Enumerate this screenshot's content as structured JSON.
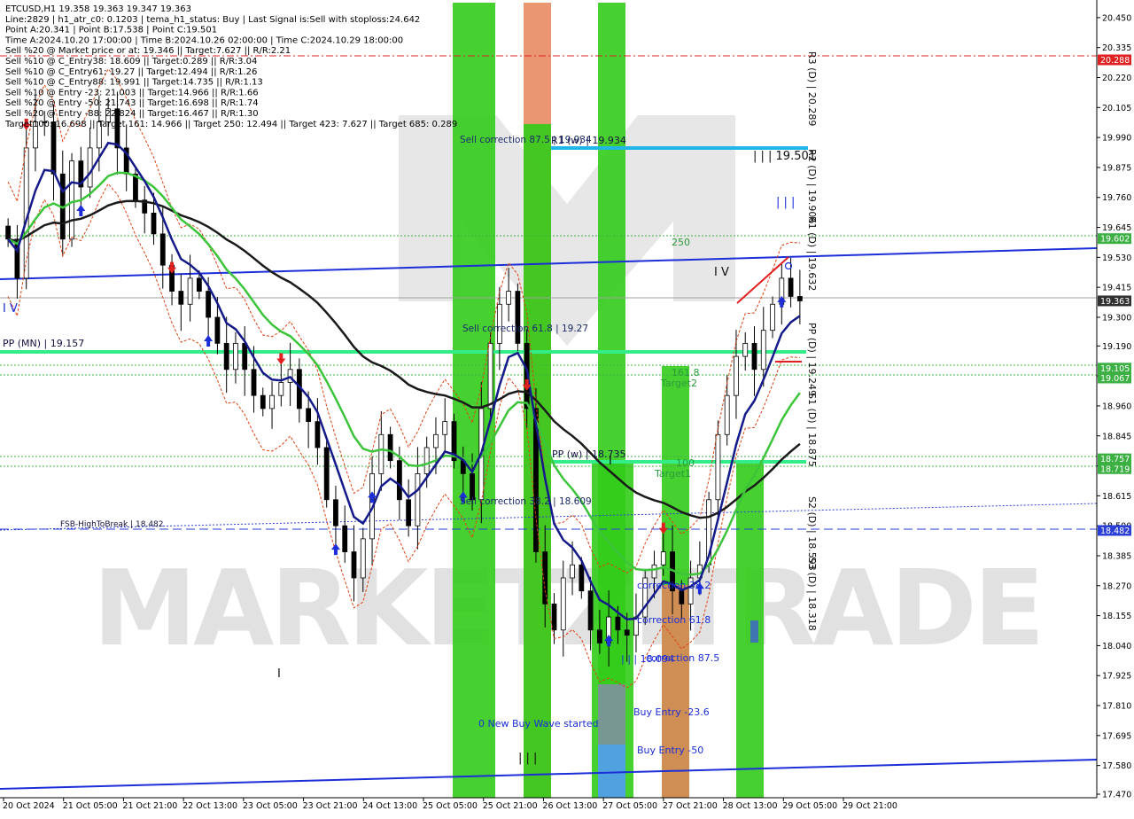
{
  "header": {
    "lines": [
      "ETCUSD,H1  19.358 19.363 19.347 19.363",
      "Line:2829 | h1_atr_c0: 0.1203 | tema_h1_status: Buy | Last Signal is:Sell with stoploss:24.642",
      "Point A:20.341 | Point B:17.538 | Point C:19.501",
      "Time A:2024.10.20 17:00:00 | Time B:2024.10.26 02:00:00 | Time C:2024.10.29 18:00:00",
      "Sell %20 @ Market price or at: 19.346 || Target:7.627 || R/R:2.21",
      "Sell %10 @ C_Entry38: 18.609 || Target:0.289 || R/R:3.04",
      "Sell %10 @ C_Entry61: 19.27 || Target:12.494 || R/R:1.26",
      "Sell %10 @ C_Entry88: 19.991 || Target:14.735 || R/R:1.13",
      "Sell %10 @ Entry -23: 21.003 || Target:14.966 || R/R:1.66",
      "Sell %20 @ Entry -50: 21.743 || Target:16.698 || R/R:1.74",
      "Sell %20 @ Entry -88: 22.824 || Target:16.467 || R/R:1.30",
      "Target100: 16.698 || Target 161: 14.966 || Target 250: 12.494 || Target 423: 7.627 || Target 685: 0.289"
    ]
  },
  "watermark": "MARKETZITRADE",
  "chart_data": {
    "type": "candlestick",
    "symbol": "ETCUSD",
    "timeframe": "H1",
    "ylim": [
      17.47,
      20.47
    ],
    "y_ticks": [
      "20.450",
      "20.335",
      "20.220",
      "20.105",
      "19.990",
      "19.875",
      "19.760",
      "19.645",
      "19.530",
      "19.415",
      "19.300",
      "19.190",
      "19.075",
      "18.960",
      "18.845",
      "18.730",
      "18.615",
      "18.500",
      "18.385",
      "18.270",
      "18.155",
      "18.040",
      "17.925",
      "17.810",
      "17.695",
      "17.580",
      "17.470"
    ],
    "x_ticks": [
      "20 Oct 2024",
      "21 Oct 05:00",
      "21 Oct 21:00",
      "22 Oct 13:00",
      "23 Oct 05:00",
      "23 Oct 21:00",
      "24 Oct 13:00",
      "25 Oct 05:00",
      "25 Oct 21:00",
      "26 Oct 13:00",
      "27 Oct 05:00",
      "27 Oct 21:00",
      "28 Oct 13:00",
      "29 Oct 05:00",
      "29 Oct 21:00"
    ],
    "price_badges": [
      {
        "value": "20.288",
        "color": "#e02020"
      },
      {
        "value": "19.602",
        "color": "#3cb043"
      },
      {
        "value": "19.363",
        "color": "#303030"
      },
      {
        "value": "19.105",
        "color": "#3cb043"
      },
      {
        "value": "19.067",
        "color": "#3cb043"
      },
      {
        "value": "18.757",
        "color": "#3cb043"
      },
      {
        "value": "18.719",
        "color": "#3cb043"
      },
      {
        "value": "18.482",
        "color": "#2a3ed8"
      }
    ],
    "anchor_points": {
      "A": 20.341,
      "B": 17.538,
      "C": 19.501
    },
    "closes": [
      19.6,
      19.45,
      19.95,
      20.05,
      20.05,
      19.85,
      19.6,
      19.9,
      19.8,
      19.95,
      20.05,
      20.1,
      19.95,
      19.85,
      19.75,
      19.7,
      19.62,
      19.5,
      19.4,
      19.35,
      19.45,
      19.4,
      19.3,
      19.2,
      19.1,
      19.2,
      19.1,
      19.0,
      18.95,
      19.0,
      19.05,
      19.1,
      18.95,
      18.9,
      18.8,
      18.6,
      18.5,
      18.4,
      18.3,
      18.45,
      18.7,
      18.85,
      18.75,
      18.6,
      18.5,
      18.7,
      18.8,
      18.85,
      18.9,
      18.75,
      18.7,
      18.6,
      18.95,
      19.2,
      19.35,
      19.4,
      19.2,
      18.95,
      18.4,
      18.2,
      18.1,
      18.3,
      18.35,
      18.25,
      18.1,
      18.05,
      18.15,
      18.1,
      18.08,
      18.15,
      18.3,
      18.35,
      18.4,
      18.25,
      18.2,
      18.3,
      18.35,
      18.6,
      18.85,
      19.0,
      19.15,
      19.2,
      19.1,
      19.25,
      19.35,
      19.45,
      19.38,
      19.363
    ],
    "labels": {
      "r3_d": "R3 (D) | 20.289",
      "r2_d": "R2 (D) | 19.906",
      "r1_d": "R1 (D) | 19.632",
      "pp_d": "PP (D) | 19.249",
      "s1_d": "S1 (D) | 18.875",
      "s2_d": "S2 (D) | 18.593",
      "s3_d": "S3 (D) | 18.318",
      "r1_w": "R1 (w) | 19.934",
      "pp_w": "PP (w) | 18.735",
      "pp_mn": "PP (MN) | 19.157",
      "fsb": "FSB-HighToBreak | 18.482",
      "sell_corr_875": "Sell correction 87.5 | 19.934",
      "sell_corr_618": "Sell correction 61.8 | 19.27",
      "sell_corr_382": "Sell correction 38.2 | 18.609",
      "iii_1950": "| | | 19.501",
      "iii_a": "| | |",
      "iii_b": "| | |",
      "iii_c": "| | | 18.094",
      "iv": "I V",
      "v_left": "I V",
      "l250": "250",
      "l1618": "161.8",
      "target2": "Target2",
      "l100": "100",
      "target1": "Target1",
      "corr382": "correction 38.2",
      "corr618": "correction 61.8",
      "corr875": "correction 87.5",
      "new_wave": "0 New Buy Wave started",
      "buy_236": "Buy Entry -23.6",
      "buy_50": "Buy Entry -50",
      "mark_i1": "I",
      "mark_i2": "I"
    }
  }
}
